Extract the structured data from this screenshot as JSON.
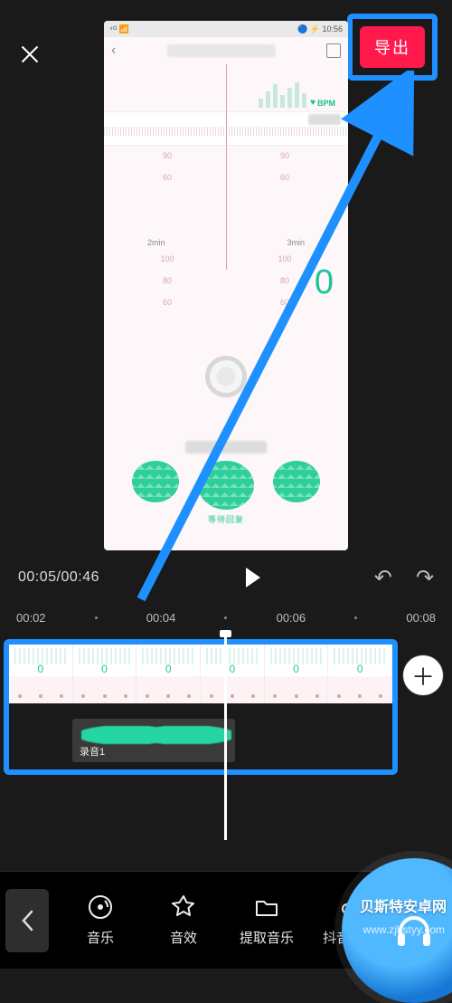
{
  "topbar": {
    "export_label": "导出"
  },
  "preview": {
    "status_left": "⁴ᴳ 📶",
    "status_right": "🔵 ⚡ 10:56",
    "bpm_label": "BPM",
    "scale_a": [
      "90",
      "60"
    ],
    "scale_b": [
      "90",
      "60"
    ],
    "min_a": "2min",
    "min_b": "3min",
    "scale2_a": [
      "100",
      "80",
      "60"
    ],
    "scale2_b": [
      "100",
      "80",
      "60"
    ],
    "big_zero": "0",
    "subtext": "等待回复"
  },
  "playback": {
    "current": "00:05",
    "total": "00:46"
  },
  "ruler": [
    "00:02",
    "00:04",
    "00:06",
    "00:08"
  ],
  "timeline": {
    "frame_zero": "0",
    "audio_clip_label": "录音1"
  },
  "toolbar": {
    "items": [
      {
        "label": "音乐"
      },
      {
        "label": "音效"
      },
      {
        "label": "提取音乐"
      },
      {
        "label": "抖音收藏"
      }
    ]
  },
  "watermark": {
    "line1": "贝斯特安卓网",
    "line2": "www.zjbstyy.com"
  }
}
